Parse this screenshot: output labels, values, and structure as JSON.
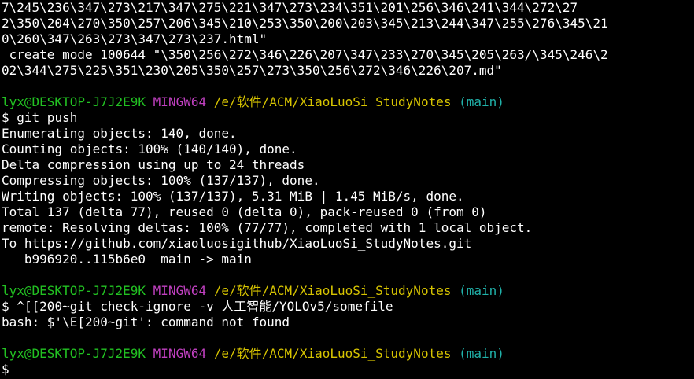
{
  "colors": {
    "background": "#000000",
    "text": "#ffffff",
    "prompt_user": "#22c122",
    "prompt_msys": "#c040c0",
    "prompt_path": "#d7c400",
    "prompt_branch": "#20b2aa"
  },
  "output_top": [
    "7\\245\\236\\347\\273\\217\\347\\275\\221\\347\\273\\234\\351\\201\\256\\346\\241\\344\\272\\27",
    "2\\350\\204\\270\\350\\257\\206\\345\\210\\253\\350\\200\\203\\345\\213\\244\\347\\255\\276\\345\\21",
    "0\\260\\347\\263\\273\\347\\273\\237.html\"",
    " create mode 100644 \"\\350\\256\\272\\346\\226\\207\\347\\233\\270\\345\\205\\263/\\345\\246\\2",
    "02\\344\\275\\225\\351\\230\\205\\350\\257\\273\\350\\256\\272\\346\\226\\207.md\""
  ],
  "prompt": {
    "user_host": "lyx@DESKTOP-J7J2E9K",
    "msystem": "MINGW64",
    "path": "/e/软件/ACM/XiaoLuoSi_StudyNotes",
    "branch": "(main)",
    "symbol": "$"
  },
  "cmd1": " git push",
  "output_push": [
    "Enumerating objects: 140, done.",
    "Counting objects: 100% (140/140), done.",
    "Delta compression using up to 24 threads",
    "Compressing objects: 100% (137/137), done.",
    "Writing objects: 100% (137/137), 5.31 MiB | 1.45 MiB/s, done.",
    "Total 137 (delta 77), reused 0 (delta 0), pack-reused 0 (from 0)",
    "remote: Resolving deltas: 100% (77/77), completed with 1 local object.",
    "To https://github.com/xiaoluosigithub/XiaoLuoSi_StudyNotes.git",
    "   b996920..115b6e0  main -> main"
  ],
  "cmd2": " ^[[200~git check-ignore -v 人工智能/YOLOv5/somefile",
  "output_cmd2": [
    "bash: $'\\E[200~git': command not found"
  ]
}
